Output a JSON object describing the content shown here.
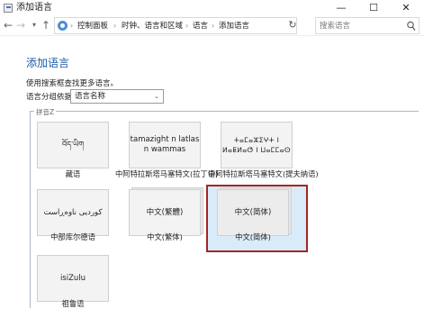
{
  "window": {
    "title": "添加语言",
    "min_glyph": "—",
    "max_glyph": "☐",
    "close_glyph": "✕"
  },
  "nav": {
    "back_glyph": "←",
    "forward_glyph": "→",
    "recent_glyph": "▾",
    "up_glyph": "↑",
    "breadcrumbs": [
      "控制面板",
      "时钟、语言和区域",
      "语言",
      "添加语言"
    ],
    "separator": "›",
    "address_dropdown_glyph": "▾",
    "refresh_glyph": "↻",
    "search_placeholder": "搜索语言"
  },
  "page": {
    "title": "添加语言",
    "description": "使用搜索框查找更多语言。",
    "group_by_label": "语言分组依据:",
    "group_by_value": "语言名称",
    "group_by_chevron": "⌄",
    "section_header": "拼音Z"
  },
  "languages": [
    {
      "tile_text": "བོད་ཡིག",
      "caption": "藏语"
    },
    {
      "tile_text": "tamazight n latlas\nn wammas",
      "caption": "中阿特拉斯塔马塞特文(拉丁语)"
    },
    {
      "tile_text": "ⵜⴰⵎⴰⵣⵉⵖⵜ ⵏ ⵍⴰⵟⵍⴰⵚ ⵏ ⵡⴰⵎⵎⴰⵙ",
      "caption": "中阿特拉斯塔马塞特文(提夫纳语)"
    },
    {
      "tile_text": "کوردیی ناوەڕاست",
      "caption": "中部库尔德语"
    },
    {
      "tile_text": "中文(繁體)",
      "caption": "中文(繁体)"
    },
    {
      "tile_text": "中文(简体)",
      "caption": "中文(简体)",
      "selected": true
    },
    {
      "tile_text": "isiZulu",
      "caption": "祖鲁语"
    }
  ],
  "colors": {
    "title_blue": "#1c5aa8",
    "selection_fill": "#d9ebf9",
    "highlight_border": "#a22525"
  }
}
